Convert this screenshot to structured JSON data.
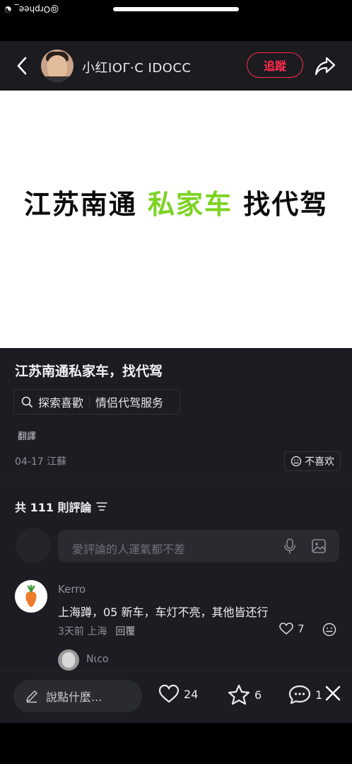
{
  "status": {
    "watermark": "@Orphee_"
  },
  "header": {
    "username": "小红ΙΟΓ·Ϲ ΙDΟϹϹ",
    "follow_label": "追蹤"
  },
  "banner": {
    "part1": "江苏南通 ",
    "part2": "私家车",
    "part3": " 找代驾",
    "highlight_color": "#7cd322"
  },
  "post": {
    "title": "江苏南通私家车，找代驾",
    "search_label": "探索喜歡",
    "tag": "情侣代驾服务",
    "translate_label": "翻譯",
    "meta": "04-17 江蘇",
    "dislike_label": "不喜欢"
  },
  "comments": {
    "count_label": "共 111 則評論",
    "input_placeholder": "愛評論的人運氣都不差",
    "items": [
      {
        "name": "Kerro",
        "text": "上海蹲，05 新车，车灯不亮，其他皆还行",
        "time": "3天前 上海",
        "reply_label": "回覆",
        "likes": "7"
      }
    ],
    "reply_preview_name": "Nιcο"
  },
  "bottom_bar": {
    "say_placeholder": "說點什麼...",
    "like_count": "24",
    "fav_count": "6",
    "comment_count": "1"
  },
  "colors": {
    "accent_red": "#ff2b4a",
    "background": "#1c1c22"
  }
}
